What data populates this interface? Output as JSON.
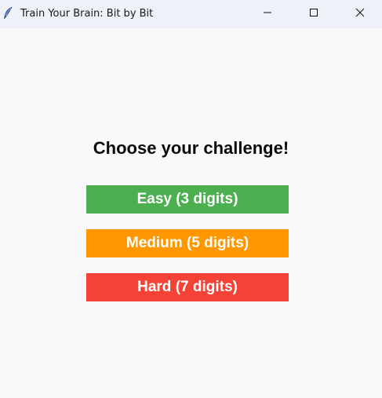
{
  "window": {
    "title": "Train Your Brain: Bit by Bit",
    "icon": "feather-icon",
    "controls": [
      "minimize-icon",
      "maximize-icon",
      "close-icon"
    ]
  },
  "main": {
    "heading": "Choose your challenge!",
    "buttons": [
      {
        "label": "Easy (3 digits)",
        "color": "#4caf50"
      },
      {
        "label": "Medium (5 digits)",
        "color": "#ff9800"
      },
      {
        "label": "Hard (7 digits)",
        "color": "#f44336"
      }
    ]
  }
}
